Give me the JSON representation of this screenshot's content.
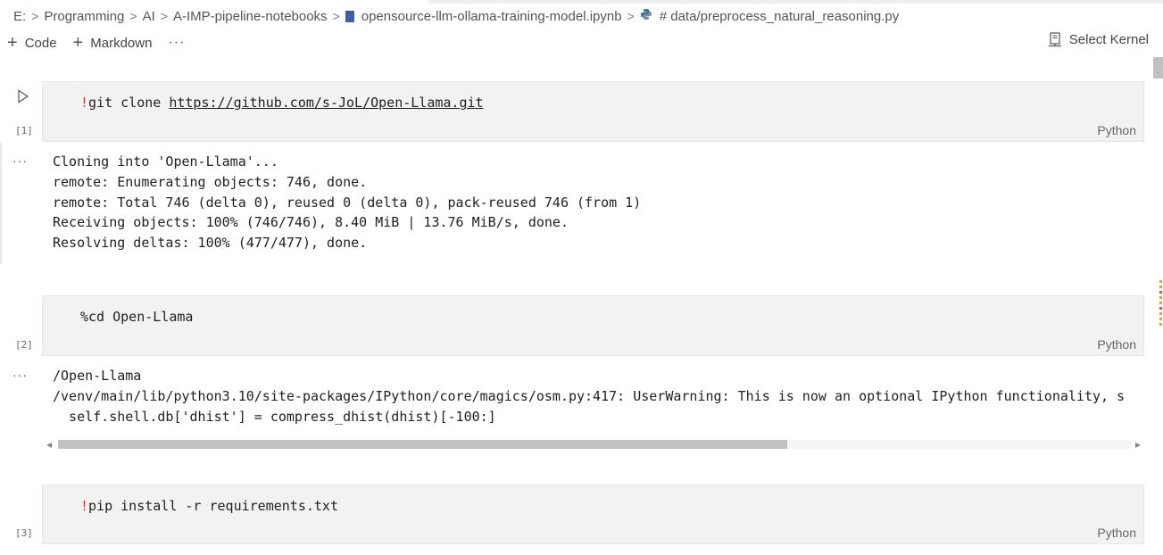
{
  "breadcrumb": {
    "items": [
      "E:",
      "Programming",
      "AI",
      "A-IMP-pipeline-notebooks",
      "opensource-llm-ollama-training-model.ipynb",
      "# data/preprocess_natural_reasoning.py"
    ],
    "separator": ">"
  },
  "toolbar": {
    "code_label": "Code",
    "markdown_label": "Markdown",
    "more_label": "···",
    "kernel_label": "Select Kernel"
  },
  "cells": [
    {
      "exec_count": "[1]",
      "bang": "!",
      "command": "git clone ",
      "url": "https://github.com/s-JoL/Open-Llama.git",
      "language": "Python",
      "output_lines": [
        "Cloning into 'Open-Llama'...",
        "remote: Enumerating objects: 746, done.",
        "remote: Total 746 (delta 0), reused 0 (delta 0), pack-reused 746 (from 1)",
        "Receiving objects: 100% (746/746), 8.40 MiB | 13.76 MiB/s, done.",
        "Resolving deltas: 100% (477/477), done."
      ]
    },
    {
      "exec_count": "[2]",
      "source": "%cd Open-Llama",
      "language": "Python",
      "output_lines": [
        "/Open-Llama",
        "/venv/main/lib/python3.10/site-packages/IPython/core/magics/osm.py:417: UserWarning: This is now an optional IPython functionality, s",
        "  self.shell.db['dhist'] = compress_dhist(dhist)[-100:]"
      ],
      "scroll_fraction_visible": 0.68
    },
    {
      "exec_count": "[3]",
      "bang": "!",
      "command": "pip install -r requirements.txt",
      "language": "Python"
    }
  ],
  "output_more_label": "···",
  "colors": {
    "cell_background": "#f2f2f2",
    "bang_red": "#d53a2b",
    "file_icon_blue": "#3a5ea8",
    "scroll_thumb": "#c1c1c1"
  }
}
